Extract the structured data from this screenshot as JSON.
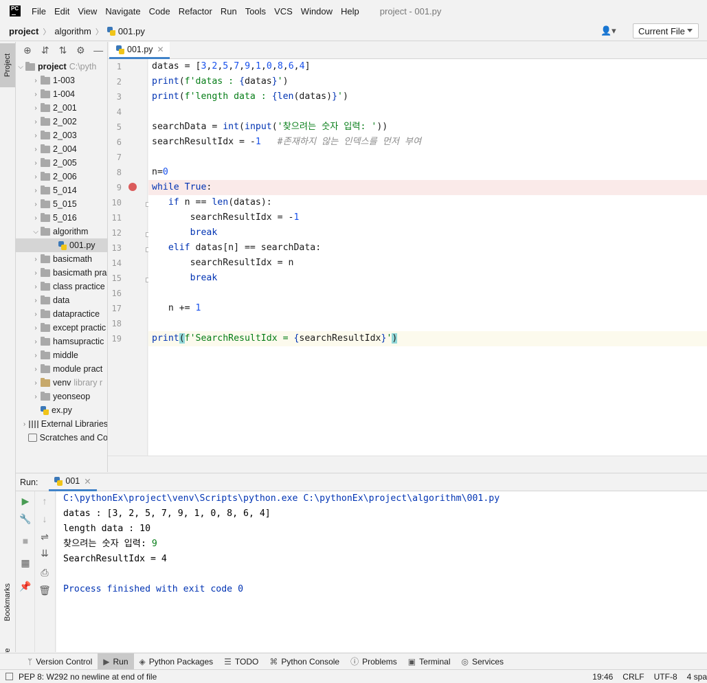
{
  "menubar": {
    "logo": "PC",
    "items": [
      "File",
      "Edit",
      "View",
      "Navigate",
      "Code",
      "Refactor",
      "Run",
      "Tools",
      "VCS",
      "Window",
      "Help"
    ],
    "window_title": "project - 001.py"
  },
  "navbar": {
    "crumbs": [
      "project",
      "algorithm",
      "001.py"
    ],
    "run_config": "Current File"
  },
  "side_tabs": {
    "project": "Project",
    "bookmarks": "Bookmarks",
    "structure": "Structure"
  },
  "project_tree": {
    "root_label": "project",
    "root_path": "C:\\pyth",
    "items": [
      {
        "label": "1-003",
        "type": "folder",
        "depth": 1
      },
      {
        "label": "1-004",
        "type": "folder",
        "depth": 1
      },
      {
        "label": "2_001",
        "type": "folder",
        "depth": 1
      },
      {
        "label": "2_002",
        "type": "folder",
        "depth": 1
      },
      {
        "label": "2_003",
        "type": "folder",
        "depth": 1
      },
      {
        "label": "2_004",
        "type": "folder",
        "depth": 1
      },
      {
        "label": "2_005",
        "type": "folder",
        "depth": 1
      },
      {
        "label": "2_006",
        "type": "folder",
        "depth": 1
      },
      {
        "label": "5_014",
        "type": "folder",
        "depth": 1
      },
      {
        "label": "5_015",
        "type": "folder",
        "depth": 1
      },
      {
        "label": "5_016",
        "type": "folder",
        "depth": 1
      },
      {
        "label": "algorithm",
        "type": "folder-open",
        "depth": 1
      },
      {
        "label": "001.py",
        "type": "pyfile",
        "depth": 2,
        "selected": true
      },
      {
        "label": "basicmath",
        "type": "folder",
        "depth": 1
      },
      {
        "label": "basicmath pra",
        "type": "folder",
        "depth": 1
      },
      {
        "label": "class practice",
        "type": "folder",
        "depth": 1
      },
      {
        "label": "data",
        "type": "folder",
        "depth": 1
      },
      {
        "label": "datapractice",
        "type": "folder",
        "depth": 1
      },
      {
        "label": "except practic",
        "type": "folder",
        "depth": 1
      },
      {
        "label": "hamsupractic",
        "type": "folder",
        "depth": 1
      },
      {
        "label": "middle",
        "type": "folder",
        "depth": 1
      },
      {
        "label": "module pract",
        "type": "folder",
        "depth": 1
      },
      {
        "label": "venv",
        "type": "libfolder",
        "depth": 1,
        "suffix": "library r"
      },
      {
        "label": "yeonseop",
        "type": "folder",
        "depth": 1
      },
      {
        "label": "ex.py",
        "type": "pyfile",
        "depth": 1
      },
      {
        "label": "External Libraries",
        "type": "libs",
        "depth": 0
      },
      {
        "label": "Scratches and Co",
        "type": "scratch",
        "depth": 0
      }
    ]
  },
  "editor": {
    "tab_label": "001.py",
    "line_numbers": [
      "1",
      "2",
      "3",
      "4",
      "5",
      "6",
      "7",
      "8",
      "9",
      "10",
      "11",
      "12",
      "13",
      "14",
      "15",
      "16",
      "17",
      "18",
      "19"
    ]
  },
  "run_panel": {
    "label": "Run:",
    "tab": "001",
    "console": [
      "C:\\pythonEx\\project\\venv\\Scripts\\python.exe C:\\pythonEx\\project\\algorithm\\001.py",
      "datas : [3, 2, 5, 7, 9, 1, 0, 8, 6, 4]",
      "length data : 10",
      "찾으려는 숫자 입력: ",
      "9",
      "SearchResultIdx = 4",
      "Process finished with exit code 0"
    ]
  },
  "bottom_tools": [
    "Version Control",
    "Run",
    "Python Packages",
    "TODO",
    "Python Console",
    "Problems",
    "Terminal",
    "Services"
  ],
  "status": {
    "message": "PEP 8: W292 no newline at end of file",
    "position": "19:46",
    "line_sep": "CRLF",
    "encoding": "UTF-8",
    "indent": "4 spa"
  }
}
